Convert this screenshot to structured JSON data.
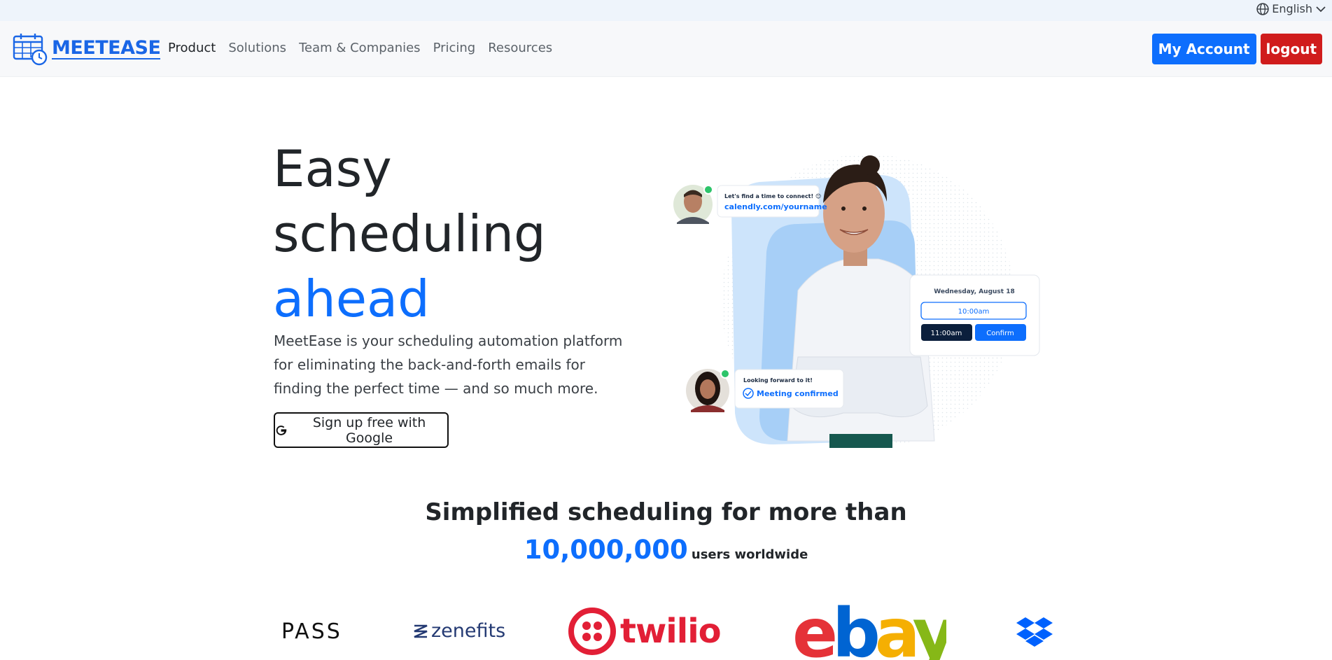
{
  "topbar": {
    "language": "English"
  },
  "navbar": {
    "brand": "MEETEASE",
    "links": [
      "Product",
      "Solutions",
      "Team & Companies",
      "Pricing",
      "Resources"
    ],
    "account_label": "My Account",
    "logout_label": "logout"
  },
  "hero": {
    "title_line1": "Easy",
    "title_line2": "scheduling",
    "title_line3": "ahead",
    "description": "MeetEase is your scheduling automation platform for eliminating the back-and-forth emails for finding the perfect time — and so much more.",
    "google_button": "Sign up free with Google"
  },
  "illustration": {
    "bubble1_small": "Let's find a time to connect! 😊",
    "bubble1_link": "calendly.com/yourname",
    "card_date": "Wednesday, August 18",
    "slot_selected": "10:00am",
    "slot_other": "11:00am",
    "confirm": "Confirm",
    "bubble2_small": "Looking forward to it!",
    "bubble2_status": "Meeting confirmed"
  },
  "stats": {
    "title": "Simplified scheduling for more than",
    "number": "10,000,000",
    "suffix": "users worldwide"
  },
  "logos": {
    "pass": "PASS",
    "zenefits": "zenefits",
    "twilio": "twilio",
    "ebay": "ebay",
    "dropbox_icon": "dropbox-icon"
  },
  "colors": {
    "accent": "#0d6efd",
    "logout": "#d01c1c",
    "brand": "#1a66e6"
  }
}
